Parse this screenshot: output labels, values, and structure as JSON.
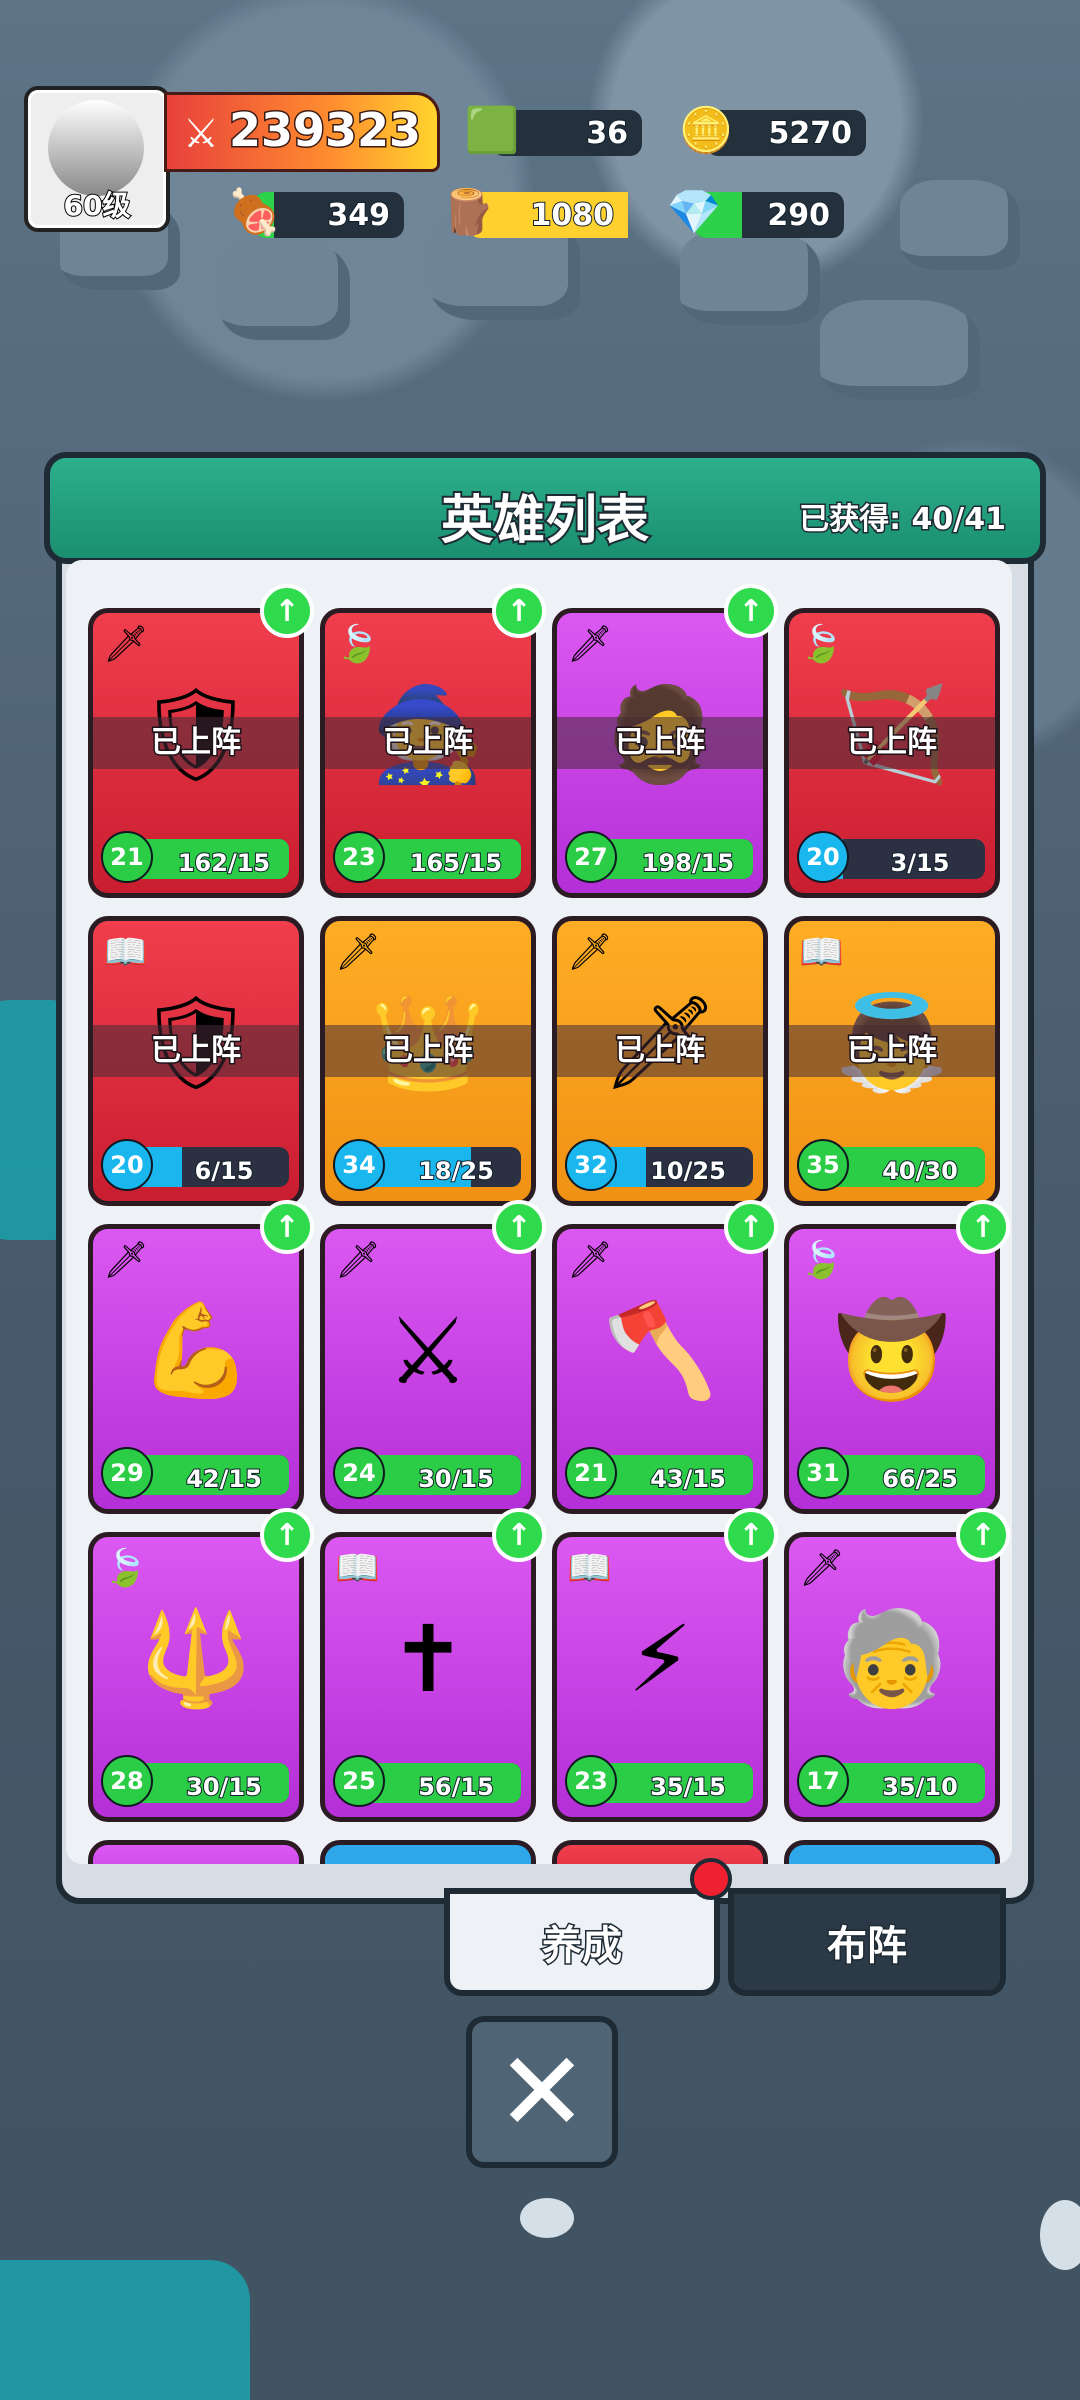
{
  "player": {
    "level": "60级",
    "power": "239323",
    "gems": "36",
    "gold": "5270",
    "meat": "349",
    "wood": "1080",
    "crystal": "290"
  },
  "panel": {
    "title": "英雄列表",
    "owned": "已获得: 40/41"
  },
  "tabs": {
    "train": "养成",
    "formation": "布阵"
  },
  "heroes": [
    {
      "level": "21",
      "fragments": "162/15",
      "deployed": "已上阵"
    },
    {
      "level": "23",
      "fragments": "165/15",
      "deployed": "已上阵"
    },
    {
      "level": "27",
      "fragments": "198/15",
      "deployed": "已上阵"
    },
    {
      "level": "20",
      "fragments": "3/15",
      "deployed": "已上阵"
    },
    {
      "level": "20",
      "fragments": "6/15",
      "deployed": "已上阵"
    },
    {
      "level": "34",
      "fragments": "18/25",
      "deployed": "已上阵"
    },
    {
      "level": "32",
      "fragments": "10/25",
      "deployed": "已上阵"
    },
    {
      "level": "35",
      "fragments": "40/30",
      "deployed": "已上阵"
    },
    {
      "level": "29",
      "fragments": "42/15"
    },
    {
      "level": "24",
      "fragments": "30/15"
    },
    {
      "level": "21",
      "fragments": "43/15"
    },
    {
      "level": "31",
      "fragments": "66/25"
    },
    {
      "level": "28",
      "fragments": "30/15"
    },
    {
      "level": "25",
      "fragments": "56/15"
    },
    {
      "level": "23",
      "fragments": "35/15"
    },
    {
      "level": "17",
      "fragments": "35/10"
    }
  ],
  "colors": {
    "panel_header": "#1a8f70",
    "red_card": "#d62b3e",
    "purple_card": "#c745e6",
    "orange_card": "#f3a21e"
  }
}
